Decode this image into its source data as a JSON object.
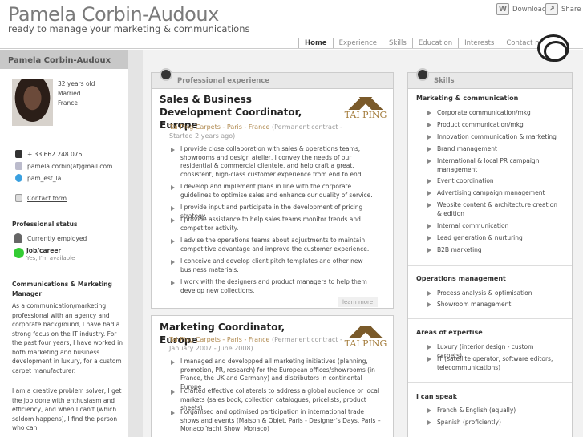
{
  "header": {
    "name": "Pamela Corbin-Audoux",
    "tagline": "ready to manage your marketing & communications",
    "download": "Download",
    "share": "Share"
  },
  "nav": [
    "Home",
    "Experience",
    "Skills",
    "Education",
    "Interests",
    "Contact me"
  ],
  "sidebar": {
    "head": "Pamela Corbin-Audoux",
    "age": "32 years old",
    "status": "Married",
    "country": "France",
    "phone": "+ 33 662 248 076",
    "email": "pamela.corbin(at)gmail.com",
    "skype": "pam_est_la",
    "contact_form": "Contact form",
    "prof_status_title": "Professional status",
    "employed": "Currently employed",
    "job_title": "Job/career",
    "job_value": "Yes, I'm available",
    "comm_title": "Communications & Marketing Manager",
    "para1": "As a communication/marketing professional with an agency and corporate background, I have had a strong focus on the IT industry. For the past four years, I have worked in both marketing and business development in luxury, for a custom carpet manufacturer.",
    "para2": "I am a creative problem solver, I get the job done with enthusiasm and efficiency, and when I can't (which seldom happens), I find the person who can"
  },
  "experience": {
    "head": "Professional experience",
    "jobs": [
      {
        "title": "Sales & Business Development Coordinator, Europe",
        "company": "Tai Ping Carpets - Paris - France",
        "meta": "(Permanent contract - Started 2 years ago)",
        "logo": "TAI PING",
        "bullets": [
          "I provide close collaboration with sales & operations teams, showrooms and design atelier, I convey the needs of our residential & commercial clientele, and help craft a great, consistent, high-class customer experience from end to end.",
          "I develop and implement plans in line with the corporate guidelines to optimise sales and enhance our quality of service.",
          "I provide input and participate in the development of pricing strategy.",
          "I provide assistance to help sales teams monitor trends and competitor activity.",
          "I advise the operations teams about adjustments to maintain competitive advantage and improve the customer experience.",
          "I conceive and develop client pitch templates and other new business materials.",
          "I work with the designers and product managers to help them develop new collections."
        ],
        "more": "learn more"
      },
      {
        "title": "Marketing Coordinator, Europe",
        "company": "Tai Ping Carpets - Paris - France",
        "meta": "(Permanent contract - January 2007 - June 2008)",
        "logo": "TAI PING",
        "bullets": [
          "I managed and developped all marketing initiatives (planning, promotion, PR, research) for the European offices/showrooms (in France, the UK and Germany) and distributors in continental Europe",
          "I crafted effective collaterals to address a global audience or local markets (sales book, collection catalogues, pricelists, product sheets)",
          "I organised and optimised participation in international trade shows and events (Maison & Objet, Paris - Designer's Days, Paris – Monaco Yacht Show, Monaco)"
        ]
      }
    ]
  },
  "skills": {
    "head": "Skills",
    "groups": [
      {
        "title": "Marketing & communication",
        "items": [
          "Corporate communication/mkg",
          "Product communication/mkg",
          "Innovation communication & marketing",
          "Brand management",
          "International & local PR campaign management",
          "Event coordination",
          "Advertising campaign management",
          "Website content & architecture creation & edition",
          "Internal communication",
          "Lead generation & nurturing",
          "B2B marketing"
        ]
      },
      {
        "title": "Operations management",
        "items": [
          "Process analysis & optimisation",
          "Showroom management"
        ]
      },
      {
        "title": "Areas of expertise",
        "items": [
          "Luxury (interior design - custom carpets)",
          "IT (satellite operator, software editors, telecommunications)"
        ]
      },
      {
        "title": "I can speak",
        "items": [
          "French & English (equally)",
          "Spanish (proficiently)"
        ]
      }
    ]
  }
}
